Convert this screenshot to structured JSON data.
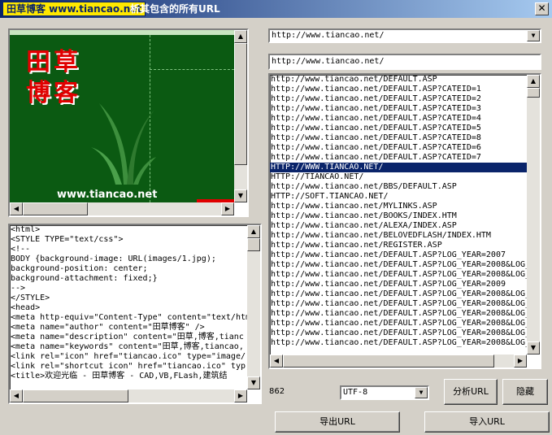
{
  "window": {
    "logo_text": "田草博客 www.tiancao.net",
    "title": "析其包含的所有URL"
  },
  "preview": {
    "logo_line1": "田草",
    "logo_line2": "博客",
    "site_text": "www.tiancao.net"
  },
  "source_code": [
    "<html>",
    "<STYLE TYPE=\"text/css\">",
    "<!--",
    "BODY {background-image: URL(images/1.jpg);",
    "background-position: center;",
    "background-attachment: fixed;}",
    "-->",
    "</STYLE>",
    "<head>",
    "<meta http-equiv=\"Content-Type\" content=\"text/htm",
    "<meta name=\"author\" content=\"田草博客\" />",
    "<meta name=\"description\" content=\"田草,博客,tianc",
    "<meta name=\"keywords\" content=\"田草,博客,tiancao,",
    "<link rel=\"icon\" href=\"tiancao.ico\" type=\"image/",
    "<link rel=\"shortcut icon\" href=\"tiancao.ico\" typ",
    "<title>欢迎光临 - 田草博客 - CAD,VB,FLash,建筑结"
  ],
  "address_combo": {
    "value": "http://www.tiancao.net/"
  },
  "url_input": {
    "value": "http://www.tiancao.net/"
  },
  "url_list": [
    "http://www.tiancao.net/DEFAULT.ASP",
    "http://www.tiancao.net/DEFAULT.ASP?CATEID=1",
    "http://www.tiancao.net/DEFAULT.ASP?CATEID=2",
    "http://www.tiancao.net/DEFAULT.ASP?CATEID=3",
    "http://www.tiancao.net/DEFAULT.ASP?CATEID=4",
    "http://www.tiancao.net/DEFAULT.ASP?CATEID=5",
    "http://www.tiancao.net/DEFAULT.ASP?CATEID=8",
    "http://www.tiancao.net/DEFAULT.ASP?CATEID=6",
    "http://www.tiancao.net/DEFAULT.ASP?CATEID=7",
    "HTTP://WWW.TIANCAO.NET/",
    "HTTP://TIANCAO.NET/",
    "http://www.tiancao.net/BBS/DEFAULT.ASP",
    "HTTP://SOFT.TIANCAO.NET/",
    "http://www.tiancao.net/MYLINKS.ASP",
    "http://www.tiancao.net/BOOKS/INDEX.HTM",
    "http://www.tiancao.net/ALEXA/INDEX.ASP",
    "http://www.tiancao.net/BELOVEDFLASH/INDEX.HTM",
    "http://www.tiancao.net/REGISTER.ASP",
    "http://www.tiancao.net/DEFAULT.ASP?LOG_YEAR=2007",
    "http://www.tiancao.net/DEFAULT.ASP?LOG_YEAR=2008&LOG_",
    "http://www.tiancao.net/DEFAULT.ASP?LOG_YEAR=2008&LOG_",
    "http://www.tiancao.net/DEFAULT.ASP?LOG_YEAR=2009",
    "http://www.tiancao.net/DEFAULT.ASP?LOG_YEAR=2008&LOG_",
    "http://www.tiancao.net/DEFAULT.ASP?LOG_YEAR=2008&LOG_",
    "http://www.tiancao.net/DEFAULT.ASP?LOG_YEAR=2008&LOG_",
    "http://www.tiancao.net/DEFAULT.ASP?LOG_YEAR=2008&LOG_",
    "http://www.tiancao.net/DEFAULT.ASP?LOG_YEAR=2008&LOG_",
    "http://www.tiancao.net/DEFAULT.ASP?LOG_YEAR=2008&LOG_"
  ],
  "selected_index": 9,
  "url_count": "862",
  "encoding_combo": {
    "value": "UTF-8"
  },
  "buttons": {
    "analyze": "分析URL",
    "hide": "隐藏",
    "export": "导出URL",
    "import": "导入URL"
  },
  "glyphs": {
    "close": "✕",
    "up": "▲",
    "down": "▼",
    "left": "◀",
    "right": "▶"
  }
}
